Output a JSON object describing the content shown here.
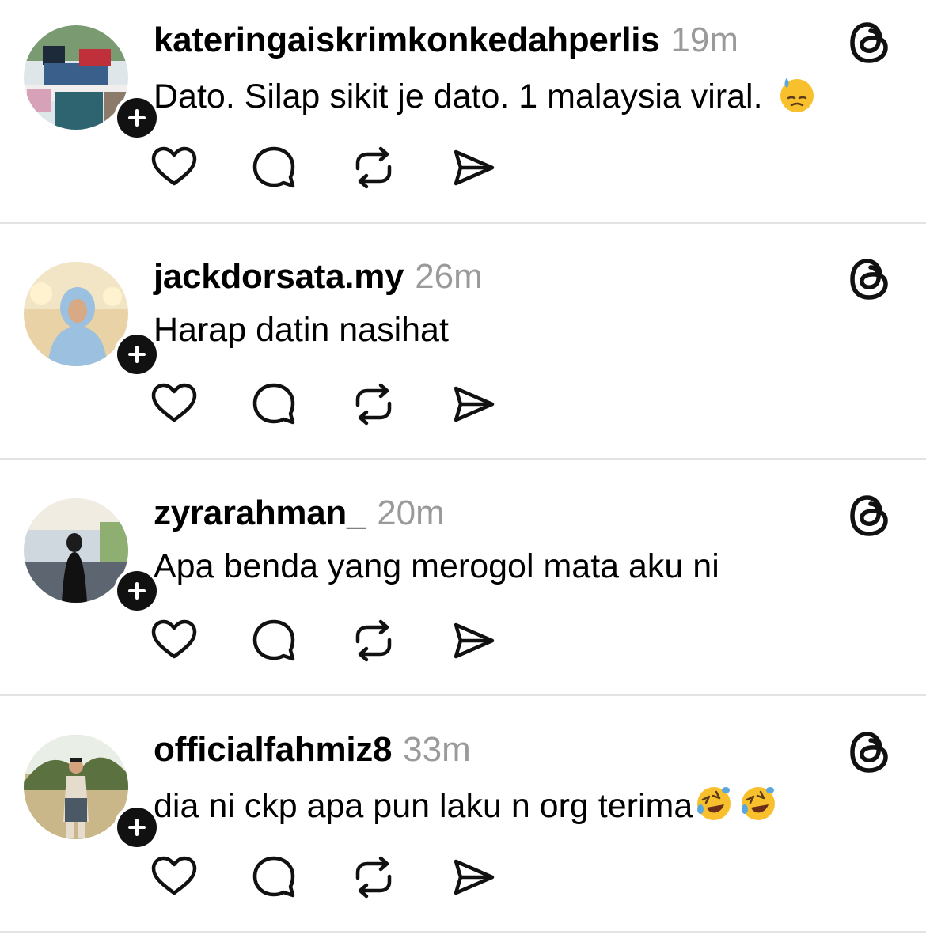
{
  "posts": [
    {
      "username": "kateringaiskrimkonkedahperlis",
      "time": "19m",
      "text": "Dato. Silap sikit je dato. 1 malaysia viral.",
      "emojis": [
        "downcast-sweat-emoji"
      ]
    },
    {
      "username": "jackdorsata.my",
      "time": "26m",
      "text": "Harap datin nasihat",
      "emojis": []
    },
    {
      "username": "zyrarahman_",
      "time": "20m",
      "text": "Apa benda yang merogol mata aku ni",
      "emojis": []
    },
    {
      "username": "officialfahmiz8",
      "time": "33m",
      "text": "dia ni ckp apa pun laku n org terima",
      "emojis": [
        "rolling-laughing-emoji",
        "rolling-laughing-emoji"
      ]
    }
  ],
  "icons": {
    "like": "heart-icon",
    "reply": "comment-icon",
    "repost": "repost-icon",
    "share": "send-icon",
    "brand": "threads-logo-icon",
    "follow": "plus-icon"
  },
  "colors": {
    "background": "#ffffff",
    "text": "#000000",
    "timestamp": "#9a9a9a",
    "divider": "#e3e3e3",
    "follow_badge": "#111111"
  }
}
